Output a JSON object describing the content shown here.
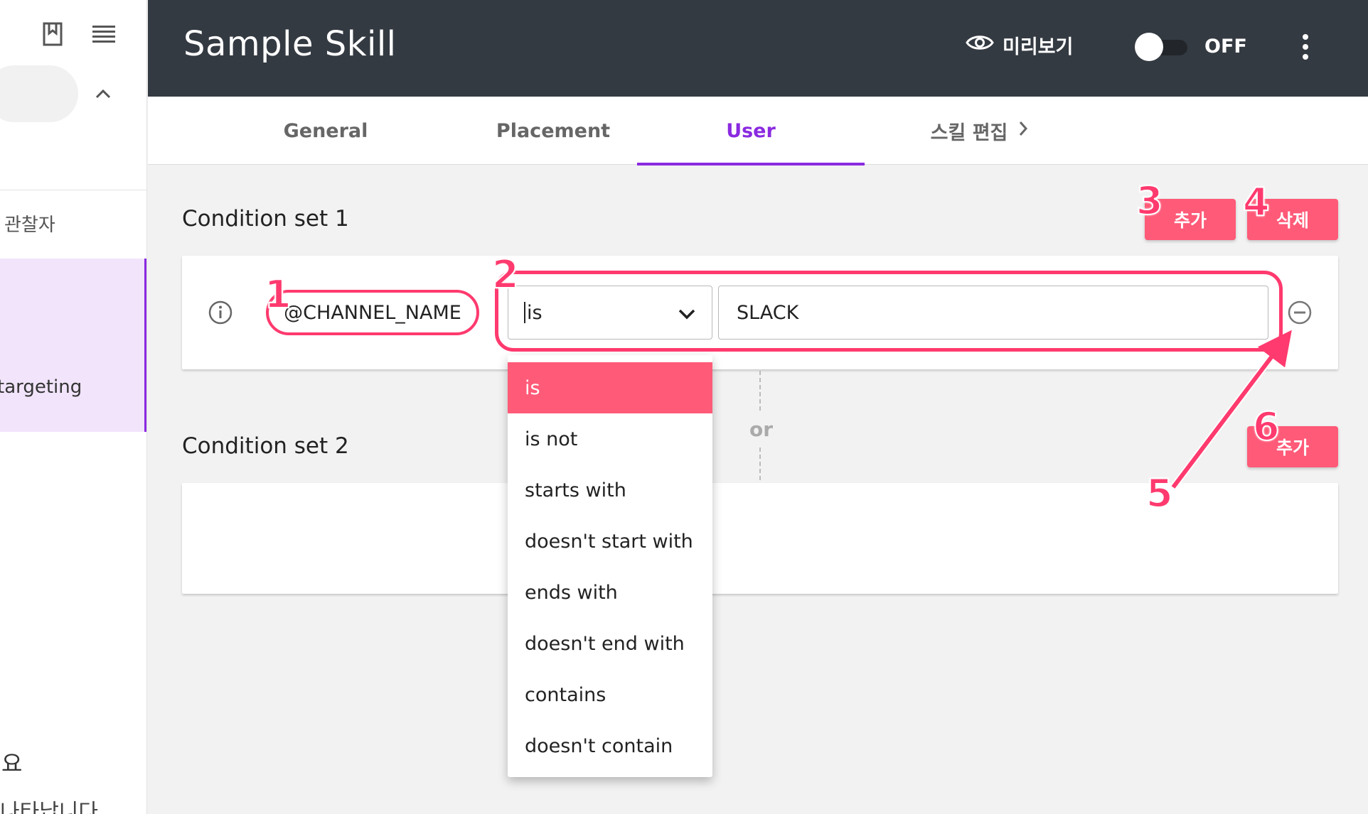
{
  "sidebar": {
    "observer_label": "관찰자",
    "active_item_label": "targeting",
    "bottom_heading": "요",
    "bottom_text": "나타납니다"
  },
  "header": {
    "title": "Sample Skill",
    "preview_label": "미리보기",
    "toggle_state": "OFF"
  },
  "tabs": [
    {
      "label": "General"
    },
    {
      "label": "Placement"
    },
    {
      "label": "User"
    },
    {
      "label": "스킬 편집"
    }
  ],
  "condition_set_1": {
    "title": "Condition set 1",
    "add_label": "추가",
    "delete_label": "삭제",
    "variable": "@CHANNEL_NAME",
    "operator": "is",
    "value": "SLACK"
  },
  "or_label": "or",
  "condition_set_2": {
    "title": "Condition set 2",
    "add_label": "추가"
  },
  "operator_options": [
    "is",
    "is not",
    "starts with",
    "doesn't start with",
    "ends with",
    "doesn't end with",
    "contains",
    "doesn't contain"
  ],
  "annotations": [
    "1",
    "2",
    "3",
    "4",
    "5",
    "6"
  ],
  "colors": {
    "accent_purple": "#8a2ae0",
    "button_pink": "#ff5a78",
    "annotation_pink": "#ff3a6e",
    "header_dark": "#343a42"
  }
}
